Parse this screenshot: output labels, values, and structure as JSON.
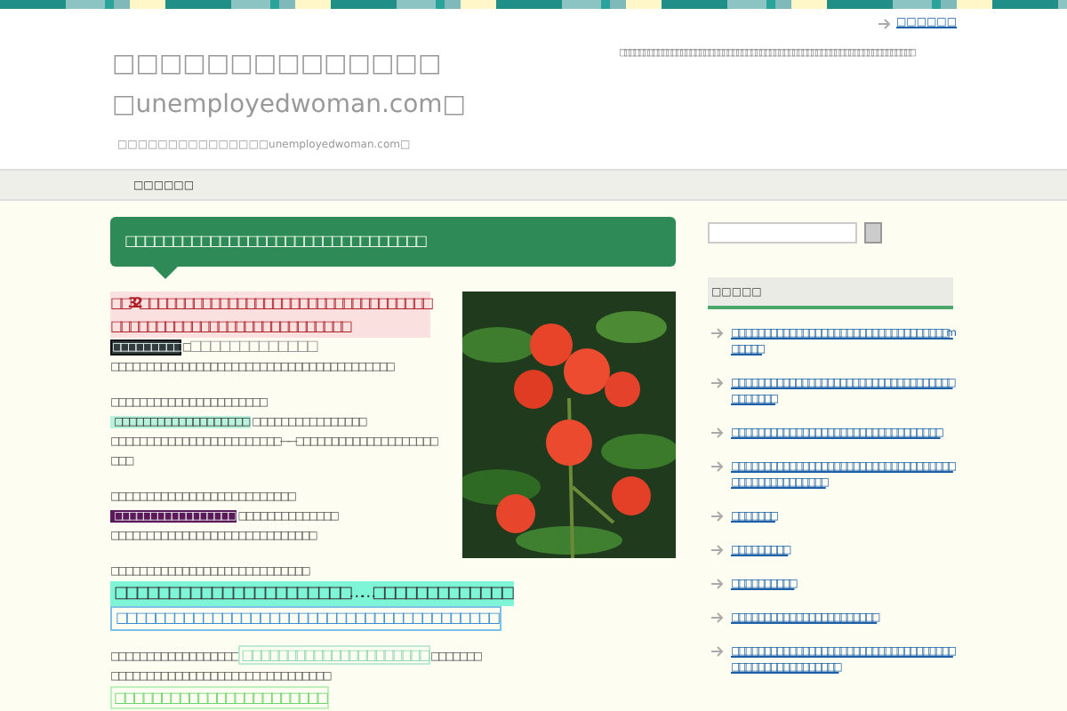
{
  "header": {
    "top_link": "□□□□□□",
    "description": "□□□□□□□□□□□□□□□□□□□□□□□□□□□□□□□□□□□□□□□□□□□□□□□□□□□□□□□□□□□□□□□",
    "title": [
      "□□□□□□□□□□□□□□",
      "□unemployedwoman.com□"
    ],
    "tagline": "□□□□□□□□□□□□□□□unemployedwoman.com□"
  },
  "nav": {
    "items": [
      {
        "label": "□□□□□□"
      }
    ]
  },
  "post": {
    "title": "□□□□□□□□□□□□□□□□□□□□□□□□□□□□□□□□",
    "paragraphs": [
      [
        [
          {
            "kind": "red",
            "text": "□□32□□□□□□□□□□□□□□□□□□□□□□□□□□□□□□□□□□□□□□□□□□□□□□□□□□□□□□□□□□□□"
          }
        ],
        [
          {
            "kind": "dark",
            "text": "□□□□□□□□□"
          },
          {
            "kind": "plain",
            "text": "□"
          },
          {
            "kind": "gray-large",
            "text": "□□□□□□□□□□□□□"
          }
        ],
        [
          {
            "kind": "plain",
            "text": "□□□□□□□□□□□□□□□□□□□□□□□□□□□□□□□□□□□□□□□□"
          }
        ]
      ],
      [
        [
          {
            "kind": "plain",
            "text": "□□□□□□□□□□□□□□□□□□□□□□"
          }
        ],
        [
          {
            "kind": "aqua",
            "text": "□□□□□□□□□□□□□□□□□□□"
          },
          {
            "kind": "plain",
            "text": " □□□□□□□□□□□□□□□□"
          }
        ],
        [
          {
            "kind": "plain",
            "text": "□□□□□□□□□□□□□□□□□□□□□□□□——□□□□□□□□□□□□□□□□□□□□□□□"
          }
        ]
      ],
      [
        [
          {
            "kind": "plain",
            "text": "□□□□□□□□□□□□□□□□□□□□□□□□□□"
          }
        ],
        [
          {
            "kind": "purple",
            "text": "□□□□□□□□□□□□□□□□□"
          },
          {
            "kind": "plain",
            "text": " □□□□□□□□□□□□□□"
          }
        ],
        [
          {
            "kind": "plain",
            "text": "□□□□□□□□□□□□□□□□□□□□□□□□□□□□□"
          }
        ]
      ],
      [
        [
          {
            "kind": "plain",
            "text": "□□□□□□□□□□□□□□□□□□□□□□□□□□□□"
          }
        ],
        [
          {
            "kind": "aqua-large",
            "text": "□□□□□□□□□□□□□□□□□□□□□□……□□□□□□□□□□□□□"
          }
        ],
        [
          {
            "kind": "blue-box",
            "text": "□□□□□□□□□□□□□□□□□□□□□□□□□□□□□□□□□□□□□□□□"
          }
        ]
      ],
      [
        [
          {
            "kind": "plain",
            "text": "□□□□□□□□□□□□□□□□□□ "
          },
          {
            "kind": "mint-box",
            "text": "□□□□□□□□□□□□□□□□□□□□□"
          },
          {
            "kind": "plain",
            "text": " □□□□□□□"
          }
        ],
        [
          {
            "kind": "plain",
            "text": "□□□□□□□□□□□□□□□□□□□□□□□□□□□□□□□"
          }
        ],
        [
          {
            "kind": "green-box",
            "text": "□□□□□□□□□□□□□□□□□□□□□□□"
          }
        ]
      ]
    ]
  },
  "sidebar": {
    "widget": {
      "title": "□□□□□",
      "links": [
        "□□□□□□□□□□□□□□□□□□□□□□□□□□□□□□□□□□ m□ □□ □□",
        "□□□□□□□□ □□□□□□□□□□□□□□□□□□□□□□□□□□□□□□□□□□",
        "□□□□□□□□□□□□□□□□□□□□□□□□□□□□□□□□□",
        "□□□□□□□□□□□□□□□□□□□□□□□□□□□□□□□□□□□□□□□□□ □□□□□□□□□",
        "□□□□□□□",
        "□□□□□□□□□",
        "□□□□□□□□□□",
        "□□□□□□□□□□□□□□□□□□□□□□□",
        "□□□□□□□□□□□□□□□□□□□□□□□□□□□□□□□□□□□□□□□□□□□□□□□□□□□□"
      ]
    }
  }
}
